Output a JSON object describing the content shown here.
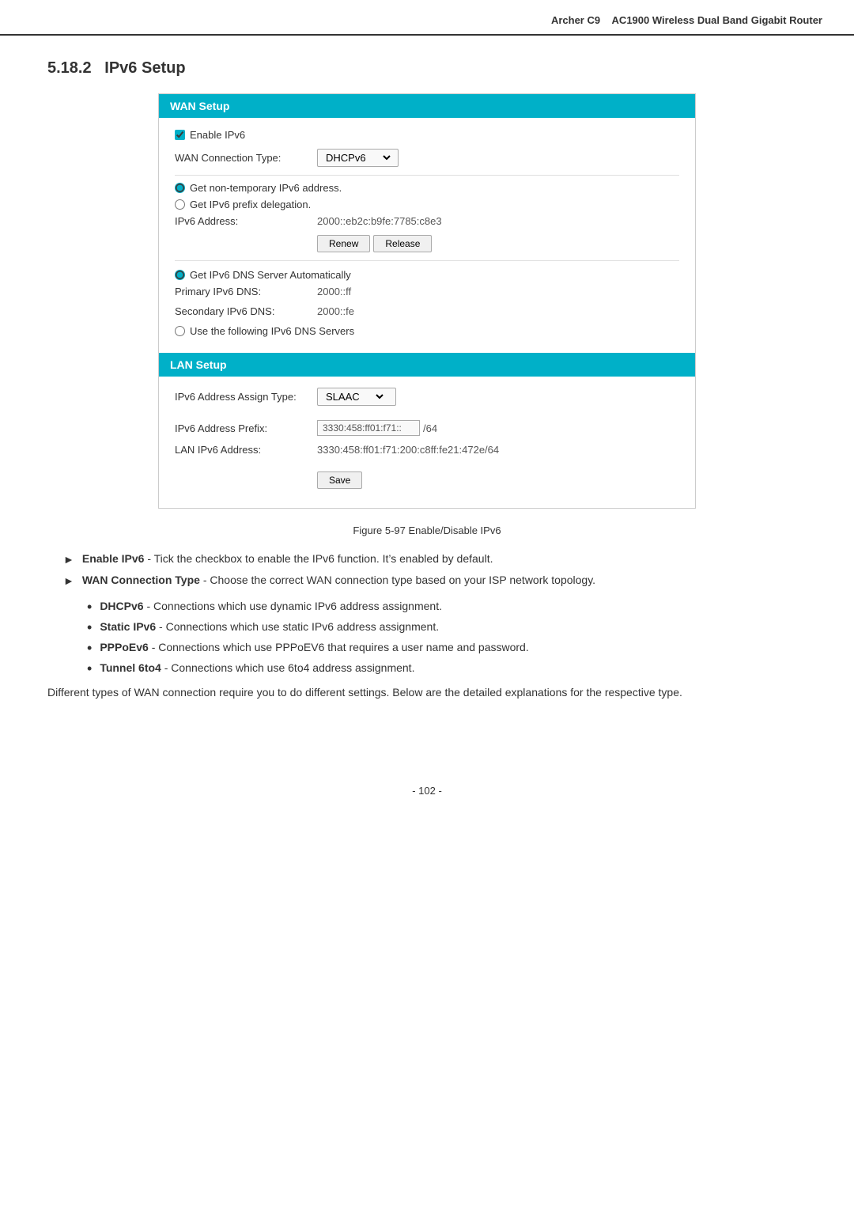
{
  "header": {
    "model": "Archer C9",
    "product": "AC1900 Wireless Dual Band Gigabit Router"
  },
  "section": {
    "number": "5.18.2",
    "title": "IPv6 Setup"
  },
  "wan_setup": {
    "header": "WAN Setup",
    "enable_ipv6_label": "Enable IPv6",
    "wan_connection_type_label": "WAN Connection Type:",
    "wan_connection_type_value": "DHCPv6",
    "radio1_label": "Get non-temporary IPv6 address.",
    "radio2_label": "Get IPv6 prefix delegation.",
    "ipv6_address_label": "IPv6 Address:",
    "ipv6_address_value": "2000::eb2c:b9fe:7785:c8e3",
    "renew_button": "Renew",
    "release_button": "Release",
    "get_dns_label": "Get IPv6 DNS Server Automatically",
    "primary_dns_label": "Primary IPv6 DNS:",
    "primary_dns_value": "2000::ff",
    "secondary_dns_label": "Secondary IPv6 DNS:",
    "secondary_dns_value": "2000::fe",
    "use_dns_label": "Use the following IPv6 DNS Servers"
  },
  "lan_setup": {
    "header": "LAN Setup",
    "assign_type_label": "IPv6 Address Assign Type:",
    "assign_type_value": "SLAAC",
    "prefix_label": "IPv6 Address Prefix:",
    "prefix_value": "3330:458:ff01:f71::",
    "prefix_suffix": "/64",
    "lan_ipv6_label": "LAN IPv6 Address:",
    "lan_ipv6_value": "3330:458:ff01:f71:200:c8ff:fe21:472e/64",
    "save_button": "Save"
  },
  "figure_caption": "Figure 5-97 Enable/Disable IPv6",
  "bullets": [
    {
      "term": "Enable IPv6",
      "desc": "- Tick the checkbox to enable the IPv6 function. It’s enabled by default."
    },
    {
      "term": "WAN Connection Type",
      "desc": "- Choose the correct WAN connection type based on your ISP network topology."
    }
  ],
  "sub_bullets": [
    {
      "term": "DHCPv6",
      "desc": "- Connections which use dynamic IPv6 address assignment."
    },
    {
      "term": "Static IPv6",
      "desc": "- Connections which use static IPv6 address assignment."
    },
    {
      "term": "PPPoEv6",
      "desc": "- Connections which use PPPoEV6 that requires a user name and password."
    },
    {
      "term": "Tunnel 6to4",
      "desc": "- Connections which use 6to4 address assignment."
    }
  ],
  "paragraph": "Different types of WAN connection require you to do different settings. Below are the detailed explanations for the respective type.",
  "footer": {
    "page_number": "- 102 -"
  }
}
